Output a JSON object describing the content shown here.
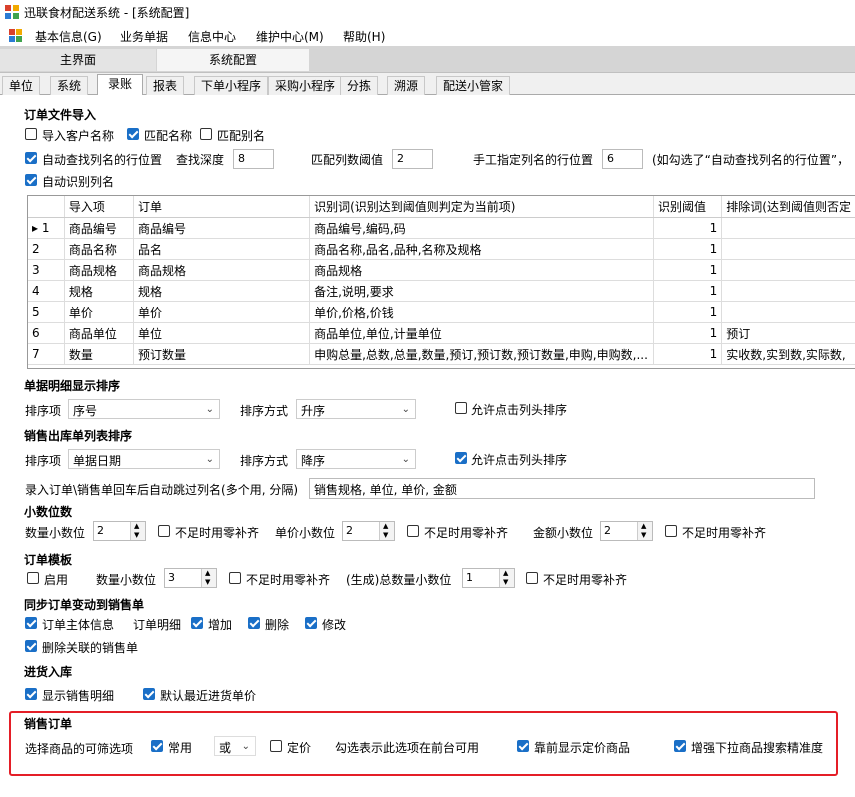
{
  "window": {
    "title": "迅联食材配送系统 - [系统配置]"
  },
  "menu": [
    "基本信息(G)",
    "业务单据",
    "信息中心",
    "维护中心(M)",
    "帮助(H)"
  ],
  "mdi_tabs": [
    "主界面",
    "系统配置"
  ],
  "sub_tabs": [
    "单位",
    "系统",
    "录账",
    "报表",
    "下单小程序",
    "采购小程序",
    "分拣",
    "溯源",
    "配送小管家"
  ],
  "order_import": {
    "title": "订单文件导入",
    "import_customer": "导入客户名称",
    "match_name": "匹配名称",
    "match_alias": "匹配别名",
    "auto_find_row": "自动查找列名的行位置",
    "search_depth_label": "查找深度",
    "search_depth": "8",
    "match_threshold_label": "匹配列数阈值",
    "match_threshold": "2",
    "manual_row_label": "手工指定列名的行位置",
    "manual_row": "6",
    "manual_row_note": "(如勾选了“自动查找列名的行位置”，",
    "auto_identify": "自动识别列名"
  },
  "grid": {
    "headers": [
      "",
      "导入项",
      "订单",
      "识别词(识别达到阈值则判定为当前项)",
      "识别阈值",
      "排除词(达到阈值则否定"
    ],
    "rows": [
      [
        "▸ 1",
        "商品编号",
        "商品编号",
        "商品编号,编码,码",
        "1",
        ""
      ],
      [
        "2",
        "商品名称",
        "品名",
        "商品名称,品名,品种,名称及规格",
        "1",
        ""
      ],
      [
        "3",
        "商品规格",
        "商品规格",
        "商品规格",
        "1",
        ""
      ],
      [
        "4",
        "规格",
        "规格",
        "备注,说明,要求",
        "1",
        ""
      ],
      [
        "5",
        "单价",
        "单价",
        "单价,价格,价钱",
        "1",
        ""
      ],
      [
        "6",
        "商品单位",
        "单位",
        "商品单位,单位,计量单位",
        "1",
        "预订"
      ],
      [
        "7",
        "数量",
        "预订数量",
        "申购总量,总数,总量,数量,预订,预订数,预订数量,申购,申购数,...",
        "1",
        "实收数,实到数,实际数,"
      ]
    ]
  },
  "detail_sort": {
    "title": "单据明细显示排序",
    "item_label": "排序项",
    "item_value": "序号",
    "mode_label": "排序方式",
    "mode_value": "升序",
    "allow_header": "允许点击列头排序"
  },
  "sales_sort": {
    "title": "销售出库单列表排序",
    "item_label": "排序项",
    "item_value": "单据日期",
    "mode_label": "排序方式",
    "mode_value": "降序",
    "allow_header": "允许点击列头排序"
  },
  "auto_jump": {
    "label": "录入订单\\销售单回车后自动跳过列名(多个用, 分隔)",
    "value": "销售规格, 单位, 单价, 金额"
  },
  "decimals": {
    "title": "小数位数",
    "qty_label": "数量小数位",
    "qty": "2",
    "price_label": "单价小数位",
    "price": "2",
    "amount_label": "金额小数位",
    "amount": "2",
    "pad_zero": "不足时用零补齐"
  },
  "order_template": {
    "title": "订单模板",
    "enable": "启用",
    "qty_label": "数量小数位",
    "qty": "3",
    "total_label": "(生成)总数量小数位",
    "total": "1",
    "pad_zero": "不足时用零补齐"
  },
  "sync": {
    "title": "同步订单变动到销售单",
    "main_info": "订单主体信息",
    "detail_label": "订单明细",
    "add": "增加",
    "delete": "删除",
    "modify": "修改",
    "delete_linked": "删除关联的销售单"
  },
  "purchase": {
    "title": "进货入库",
    "show_detail": "显示销售明细",
    "default_price": "默认最近进货单价"
  },
  "sales_order": {
    "title": "销售订单",
    "filter_label": "选择商品的可筛选项",
    "common": "常用",
    "logic_value": "或",
    "priced": "定价",
    "hint": "勾选表示此选项在前台可用",
    "front_priced": "靠前显示定价商品",
    "enhance_search": "增强下拉商品搜索精准度"
  },
  "colors": {
    "accent": "#1a6fc7",
    "highlight_box": "#e41e27"
  }
}
